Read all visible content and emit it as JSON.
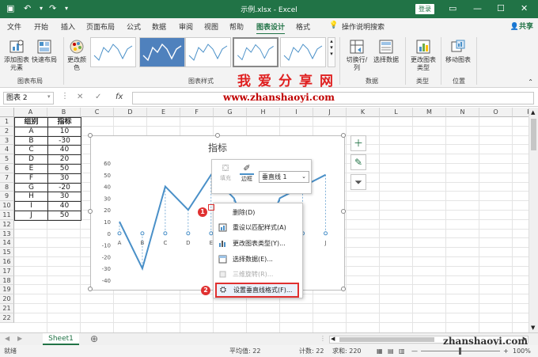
{
  "titlebar": {
    "title": "示例.xlsx  -  Excel",
    "login": "登录"
  },
  "tabs": [
    "文件",
    "开始",
    "插入",
    "页面布局",
    "公式",
    "数据",
    "审阅",
    "视图",
    "帮助",
    "图表设计",
    "格式"
  ],
  "active_tab": "图表设计",
  "tellme": "操作说明搜索",
  "share": "共享",
  "ribbon": {
    "add_element": "添加图表元素",
    "quick_layout": "快速布局",
    "change_color": "更改颜色",
    "switch_rowcol": "切换行/列",
    "select_data": "选择数据",
    "change_type": "更改图表类型",
    "move_chart": "移动图表",
    "groups": {
      "layout": "图表布局",
      "styles": "图表样式",
      "data": "数据",
      "type": "类型",
      "location": "位置"
    }
  },
  "watermark_top": "我爱分享网",
  "watermark_url": "www.zhanshaoyi.com",
  "watermark_bottom": "zhanshaoyi.com",
  "namebox": "图表 2",
  "fx": "fx",
  "columns": [
    "A",
    "B",
    "C",
    "D",
    "E",
    "F",
    "G",
    "H",
    "I",
    "J",
    "K",
    "L",
    "M",
    "N",
    "O",
    "P"
  ],
  "rows": [
    "1",
    "2",
    "3",
    "4",
    "5",
    "6",
    "7",
    "8",
    "9",
    "10",
    "11",
    "12",
    "13",
    "14",
    "15",
    "16",
    "17",
    "18",
    "19",
    "20",
    "21",
    "22"
  ],
  "table": {
    "headers": [
      "组别",
      "指标"
    ],
    "rows": [
      [
        "A",
        "10"
      ],
      [
        "B",
        "-30"
      ],
      [
        "C",
        "40"
      ],
      [
        "D",
        "20"
      ],
      [
        "E",
        "50"
      ],
      [
        "F",
        "30"
      ],
      [
        "G",
        "-20"
      ],
      [
        "H",
        "30"
      ],
      [
        "I",
        "40"
      ],
      [
        "J",
        "50"
      ]
    ]
  },
  "chart_data": {
    "type": "line",
    "title": "指标",
    "categories": [
      "A",
      "B",
      "C",
      "D",
      "E",
      "F",
      "G",
      "H",
      "I",
      "J"
    ],
    "values": [
      10,
      -30,
      40,
      20,
      50,
      30,
      -20,
      30,
      40,
      50
    ],
    "ylim": [
      -40,
      60
    ],
    "yticks": [
      "60",
      "50",
      "40",
      "30",
      "20",
      "10",
      "0",
      "-10",
      "-20",
      "-30",
      "-40"
    ],
    "grid": false,
    "color": "#4a90c8"
  },
  "minibar": {
    "fill": "填充",
    "border": "边框",
    "series_select": "垂直线 1"
  },
  "context_menu": [
    {
      "label": "删除(D)",
      "enabled": true
    },
    {
      "label": "重设以匹配样式(A)",
      "enabled": true
    },
    {
      "label": "更改图表类型(Y)...",
      "enabled": true
    },
    {
      "label": "选择数据(E)...",
      "enabled": true
    },
    {
      "label": "三维旋转(R)...",
      "enabled": false
    },
    {
      "label": "设置垂直线格式(F)...",
      "enabled": true
    }
  ],
  "badges": [
    "1",
    "2"
  ],
  "sheet_tab": "Sheet1",
  "status": {
    "ready": "就绪",
    "average": "平均值: 22",
    "count": "计数: 22",
    "sum": "求和: 220",
    "zoom": "100%"
  },
  "colors": {
    "brand": "#217346",
    "highlight": "#e03030"
  }
}
